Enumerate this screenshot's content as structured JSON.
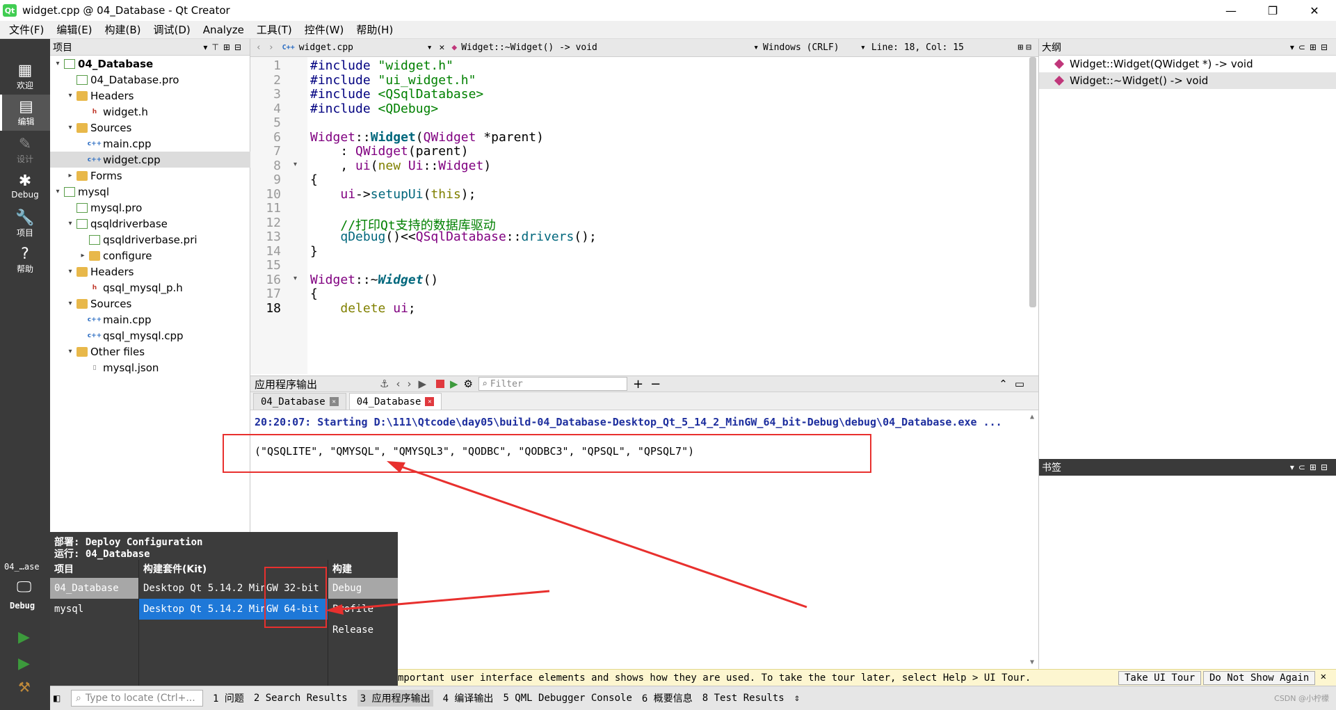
{
  "window": {
    "title": "widget.cpp @ 04_Database - Qt Creator",
    "app_icon": "Qt"
  },
  "menu": [
    "文件(F)",
    "编辑(E)",
    "构建(B)",
    "调试(D)",
    "Analyze",
    "工具(T)",
    "控件(W)",
    "帮助(H)"
  ],
  "modes": [
    {
      "label": "欢迎",
      "icon": "grid-icon"
    },
    {
      "label": "编辑",
      "icon": "document-icon"
    },
    {
      "label": "设计",
      "icon": "pencil-icon"
    },
    {
      "label": "Debug",
      "icon": "bug-icon"
    },
    {
      "label": "项目",
      "icon": "wrench-icon"
    },
    {
      "label": "帮助",
      "icon": "help-icon"
    }
  ],
  "project_panel": {
    "title": "项目"
  },
  "tree": [
    {
      "label": "04_Database",
      "level": 0,
      "icon": "pro",
      "arrow": "▾",
      "bold": true
    },
    {
      "label": "04_Database.pro",
      "level": 1,
      "icon": "pro",
      "arrow": ""
    },
    {
      "label": "Headers",
      "level": 1,
      "icon": "folder",
      "arrow": "▾"
    },
    {
      "label": "widget.h",
      "level": 2,
      "icon": "h",
      "arrow": ""
    },
    {
      "label": "Sources",
      "level": 1,
      "icon": "folder",
      "arrow": "▾"
    },
    {
      "label": "main.cpp",
      "level": 2,
      "icon": "cpp",
      "arrow": ""
    },
    {
      "label": "widget.cpp",
      "level": 2,
      "icon": "cpp",
      "arrow": "",
      "selected": true
    },
    {
      "label": "Forms",
      "level": 1,
      "icon": "folder",
      "arrow": "▸"
    },
    {
      "label": "mysql",
      "level": 0,
      "icon": "pro",
      "arrow": "▾"
    },
    {
      "label": "mysql.pro",
      "level": 1,
      "icon": "pro",
      "arrow": ""
    },
    {
      "label": "qsqldriverbase",
      "level": 1,
      "icon": "pro",
      "arrow": "▾"
    },
    {
      "label": "qsqldriverbase.pri",
      "level": 2,
      "icon": "pro",
      "arrow": ""
    },
    {
      "label": "configure",
      "level": 2,
      "icon": "folder",
      "arrow": "▸"
    },
    {
      "label": "Headers",
      "level": 1,
      "icon": "folder",
      "arrow": "▾"
    },
    {
      "label": "qsql_mysql_p.h",
      "level": 2,
      "icon": "h",
      "arrow": ""
    },
    {
      "label": "Sources",
      "level": 1,
      "icon": "folder",
      "arrow": "▾"
    },
    {
      "label": "main.cpp",
      "level": 2,
      "icon": "cpp",
      "arrow": ""
    },
    {
      "label": "qsql_mysql.cpp",
      "level": 2,
      "icon": "cpp",
      "arrow": ""
    },
    {
      "label": "Other files",
      "level": 1,
      "icon": "folder",
      "arrow": "▾"
    },
    {
      "label": "mysql.json",
      "level": 2,
      "icon": "json",
      "arrow": ""
    }
  ],
  "editor_bar": {
    "file": "widget.cpp",
    "symbol": "Widget::~Widget() -> void",
    "encoding": "Windows (CRLF)",
    "position": "Line: 18, Col: 15"
  },
  "code": {
    "line_numbers": [
      "1",
      "2",
      "3",
      "4",
      "5",
      "6",
      "7",
      "8",
      "9",
      "10",
      "11",
      "12",
      "13",
      "14",
      "15",
      "16",
      "17",
      "18"
    ],
    "current_line": 18,
    "lines": [
      "<span class=\"inc\">#include</span> <span class=\"str\">\"widget.h\"</span>",
      "<span class=\"inc\">#include</span> <span class=\"str\">\"ui_widget.h\"</span>",
      "<span class=\"inc\">#include</span> <span class=\"str\">&lt;QSqlDatabase&gt;</span>",
      "<span class=\"inc\">#include</span> <span class=\"str\">&lt;QDebug&gt;</span>",
      "",
      "<span class=\"ty\">Widget</span>::<span class=\"fn\"><b>Widget</b></span>(<span class=\"ty\">QWidget</span> *parent)",
      "    : <span class=\"ty\">QWidget</span>(parent)",
      "    , <span class=\"ty\">ui</span>(<span class=\"kw\">new</span> <span class=\"ty\">Ui</span>::<span class=\"ty\">Widget</span>)",
      "{",
      "    <span class=\"ty\">ui</span>-&gt;<span class=\"fn\">setupUi</span>(<span class=\"kw\">this</span>);",
      "",
      "    <span class=\"cm\">//打印Qt支持的数据库驱动</span>",
      "    <span class=\"fn\">qDebug</span>()&lt;&lt;<span class=\"ty\">QSqlDatabase</span>::<span class=\"fn\">drivers</span>();",
      "}",
      "",
      "<span class=\"ty\">Widget</span>::~<span class=\"it\">Widget</span>()",
      "{",
      "    <span class=\"kw\">delete</span> <span class=\"ty\">ui</span>;"
    ]
  },
  "outline": {
    "title": "大纲",
    "items": [
      "Widget::Widget(QWidget *) -> void",
      "Widget::~Widget() -> void"
    ]
  },
  "bookmarks": {
    "title": "书签"
  },
  "output": {
    "title": "应用程序输出",
    "filter_placeholder": "Filter",
    "tabs": [
      "04_Database",
      "04_Database"
    ],
    "line1": "20:20:07: Starting D:\\111\\Qtcode\\day05\\build-04_Database-Desktop_Qt_5_14_2_MinGW_64_bit-Debug\\debug\\04_Database.exe ...",
    "line2": "(\"QSQLITE\", \"QMYSQL\", \"QMYSQL3\", \"QODBC\", \"QODBC3\", \"QPSQL\", \"QPSQL7\")"
  },
  "kit_popup": {
    "deploy": "部署: Deploy Configuration",
    "run": "运行: 04_Database",
    "col_project": "项目",
    "col_kit": "构建套件(Kit)",
    "col_build": "构建",
    "projects": [
      "04_Database",
      "mysql"
    ],
    "kits": [
      "Desktop Qt 5.14.2 MinGW 32-bit",
      "Desktop Qt 5.14.2 MinGW 64-bit"
    ],
    "builds": [
      "Debug",
      "Profile",
      "Release"
    ]
  },
  "kit_selector": {
    "project": "04_…ase",
    "mode": "Debug"
  },
  "tour": {
    "text": "mportant user interface elements and shows how they are used. To take the tour later, select Help > UI Tour.",
    "take": "Take UI Tour",
    "dismiss": "Do Not Show Again"
  },
  "status": {
    "locate_placeholder": "Type to locate (Ctrl+...",
    "tabs": [
      "1 问题",
      "2 Search Results",
      "3 应用程序输出",
      "4 编译输出",
      "5 QML Debugger Console",
      "6 概要信息",
      "8 Test Results"
    ],
    "watermark": "CSDN @小柠檬"
  },
  "colors": {
    "annotation_red": "#e8302e",
    "accent_blue": "#1e78d8",
    "mode_bar": "#3a3a3a"
  }
}
